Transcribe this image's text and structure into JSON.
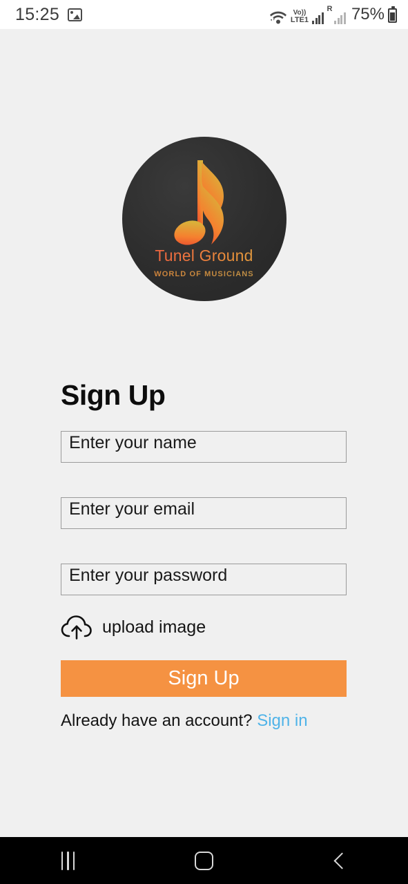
{
  "statusbar": {
    "time": "15:25",
    "notification_icon": "photo-icon",
    "wifi_icon": "wifi-icon",
    "volte_line1": "Vo))",
    "volte_line2": "LTE1",
    "signal_icon": "signal-bars-icon",
    "roaming_badge": "R",
    "battery_percent": "75%",
    "battery_icon": "battery-icon"
  },
  "logo": {
    "title": "Tunel Ground",
    "subtitle": "WORLD OF MUSICIANS",
    "icon": "music-note-icon",
    "background_color": "#2d2d2d",
    "accent_color": "#e8553f"
  },
  "form": {
    "heading": "Sign Up",
    "fields": [
      {
        "name": "name",
        "placeholder": "Enter your name"
      },
      {
        "name": "email",
        "placeholder": "Enter your email"
      },
      {
        "name": "password",
        "placeholder": "Enter your password"
      }
    ],
    "upload": {
      "label": "upload image",
      "icon": "cloud-upload-icon"
    },
    "submit_label": "Sign Up",
    "submit_color": "#f59242",
    "footer_text": "Already have an account?",
    "footer_link": "Sign in",
    "footer_link_color": "#4fb3e8"
  },
  "navbar": {
    "recents_icon": "recents-icon",
    "home_icon": "home-icon",
    "back_icon": "back-icon"
  }
}
